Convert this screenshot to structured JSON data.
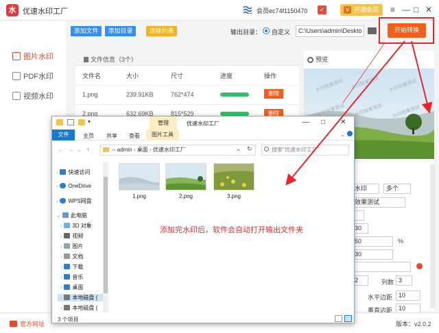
{
  "app": {
    "title": "优速水印工厂",
    "logo_text": "水",
    "user_name": "会员ec74f1150470",
    "user_badge": "✓",
    "vip_button": "开通会员",
    "vip_icon": "V",
    "window_controls": [
      "≡",
      "—",
      "□",
      "✕"
    ]
  },
  "nav": {
    "items": [
      {
        "label": "图片水印",
        "active": true
      },
      {
        "label": "PDF水印",
        "active": false
      },
      {
        "label": "视频水印",
        "active": false
      }
    ]
  },
  "toolbar": {
    "add_file": "添加文件",
    "add_dir": "添加目录",
    "clear_list": "清除列表",
    "output_label": "输出目录：",
    "radio_label": "自定义",
    "output_path": "C:\\Users\\admin\\Deskto",
    "start": "开始转换"
  },
  "file_panel": {
    "title": "文件信息（3个）",
    "columns": [
      "文件名",
      "大小",
      "尺寸",
      "进度",
      "操作"
    ],
    "rows": [
      {
        "name": "1.png",
        "size": "239.91KB",
        "dims": "762*474",
        "progress": 1.0,
        "action": "删除"
      },
      {
        "name": "2.png",
        "size": "632.69KB",
        "dims": "815*529",
        "progress": 1.0,
        "action": "删除"
      }
    ]
  },
  "preview": {
    "title": "预览",
    "watermark": "水印效果测试"
  },
  "settings": {
    "type_value": "水印",
    "mode_value": "多个",
    "text_value": "效果测试",
    "v1": "30",
    "v2": "50",
    "v2_unit": "%",
    "v3": "30",
    "rows_value": "2",
    "cols_label": "列数",
    "cols_value": "3",
    "h_margin_label": "水平边距",
    "h_margin_value": "10",
    "v_margin_label": "垂直边距",
    "v_margin_value": "10"
  },
  "status": {
    "site": "官方网址",
    "version": "版本：v2.0.2"
  },
  "explorer": {
    "manage_tab": "管理",
    "title": "优速水印工厂",
    "tabs": [
      "文件",
      "主页",
      "共享",
      "查看"
    ],
    "pic_tools_tab": "图片工具",
    "address": [
      "admin",
      "桌面",
      "优速水印工厂"
    ],
    "search_placeholder": "搜索\"优速水印工厂\"",
    "tree": [
      {
        "label": "快速访问",
        "icon": "star-icon"
      },
      {
        "label": "OneDrive",
        "icon": "cloud-icon"
      },
      {
        "label": "WPS网盘",
        "icon": "cloud-icon"
      },
      {
        "label": "此电脑",
        "icon": "computer-icon"
      },
      {
        "label": "3D 对象",
        "icon": "cube-icon"
      },
      {
        "label": "视频",
        "icon": "video-icon"
      },
      {
        "label": "图片",
        "icon": "picture-icon"
      },
      {
        "label": "文档",
        "icon": "document-icon"
      },
      {
        "label": "下载",
        "icon": "download-icon"
      },
      {
        "label": "音乐",
        "icon": "music-icon"
      },
      {
        "label": "桌面",
        "icon": "desktop-icon"
      },
      {
        "label": "本地磁盘 (",
        "icon": "drive-icon"
      },
      {
        "label": "本地磁盘 (",
        "icon": "drive-icon"
      }
    ],
    "files": [
      "1.png",
      "2.png",
      "3.png"
    ],
    "status": "3 个项目"
  },
  "annotation": "添加完水印后，软件会自动打开输出文件夹",
  "colors": {
    "accent_orange": "#f05f1b",
    "blue_button": "#2f8ff5",
    "yellow_button": "#f6b21a",
    "annotation_red": "#e8262b",
    "progress_green": "#2ec36a"
  }
}
